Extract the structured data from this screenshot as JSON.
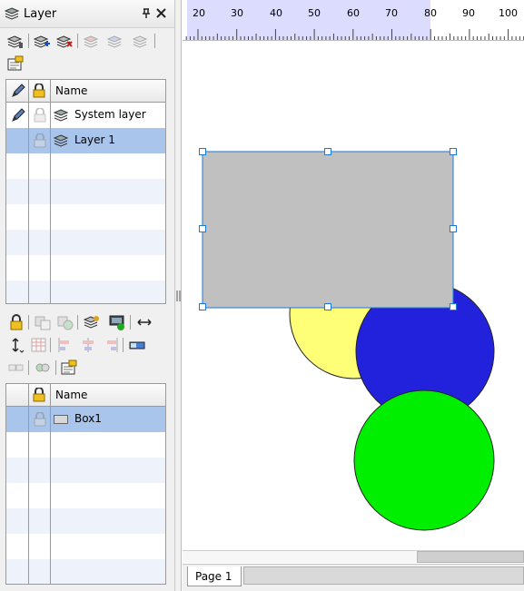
{
  "panel": {
    "title": "Layer",
    "pin_icon": "pin-icon",
    "close_icon": "close-icon"
  },
  "layer_toolbar": {
    "icons": [
      "layers-properties-icon",
      "add-layer-icon",
      "delete-layer-icon",
      "layer-up-icon",
      "layer-down-icon",
      "layer-merge-icon",
      "layer-settings-icon"
    ]
  },
  "layer_table": {
    "columns": {
      "edit_icon": "pencil-icon",
      "lock_icon": "lock-icon",
      "name": "Name"
    },
    "rows": [
      {
        "name": "System layer",
        "selected": false,
        "editable": true
      },
      {
        "name": "Layer 1",
        "selected": true,
        "editable": false
      }
    ]
  },
  "object_toolbar": {
    "icons": [
      "lock-icon",
      "send-back-icon",
      "bring-front-icon",
      "layer-move-icon",
      "export-icon",
      "flip-horizontal-icon",
      "flip-vertical-icon",
      "table-icon",
      "align-left-icon",
      "align-center-icon",
      "align-right-icon",
      "rectangle-icon",
      "group-icon",
      "ungroup-icon",
      "properties-icon"
    ]
  },
  "object_table": {
    "columns": {
      "lock_icon": "lock-icon",
      "name": "Name"
    },
    "rows": [
      {
        "name": "Box1",
        "selected": true
      }
    ]
  },
  "ruler": {
    "labels": [
      "20",
      "30",
      "40",
      "50",
      "60",
      "70",
      "80",
      "90",
      "100"
    ]
  },
  "canvas_shapes": {
    "rectangle_color": "#c0c0c0",
    "yellow_circle_color": "#ffff77",
    "blue_circle_color": "#2222dd",
    "green_circle_color": "#00ee00",
    "handle_color": "#1e7ad6"
  },
  "tabs": {
    "page_tab": "Page 1"
  }
}
